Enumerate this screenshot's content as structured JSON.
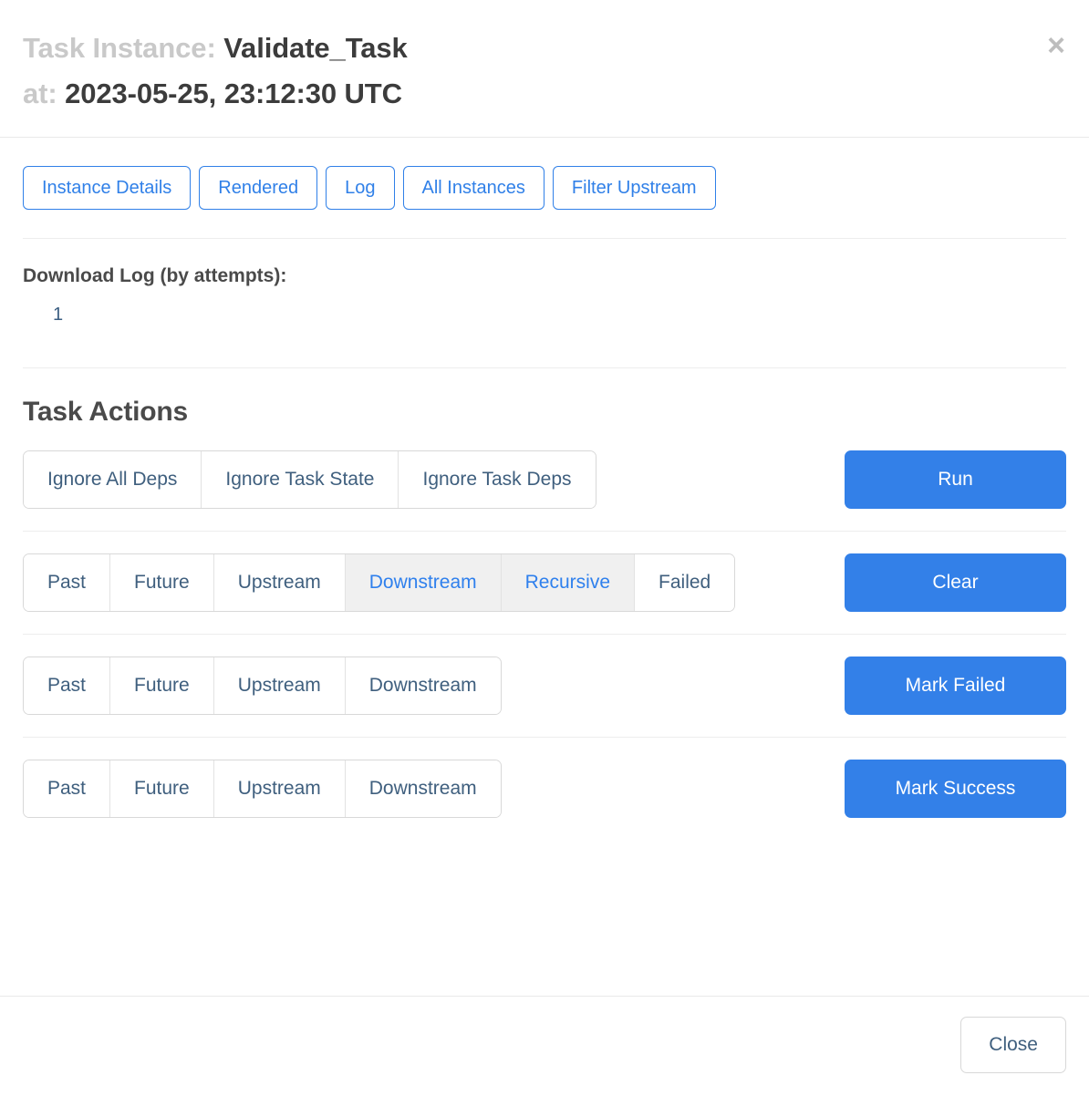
{
  "header": {
    "title_label": "Task Instance:",
    "title_value": "Validate_Task",
    "at_label": "at:",
    "at_value": "2023-05-25, 23:12:30 UTC",
    "close_icon": "×"
  },
  "tabs": [
    {
      "label": "Instance Details"
    },
    {
      "label": "Rendered"
    },
    {
      "label": "Log"
    },
    {
      "label": "All Instances"
    },
    {
      "label": "Filter Upstream"
    }
  ],
  "download_log": {
    "label": "Download Log (by attempts):",
    "attempts": [
      {
        "label": "1"
      }
    ]
  },
  "task_actions": {
    "heading": "Task Actions",
    "rows": [
      {
        "name": "run",
        "segments": [
          {
            "label": "Ignore All Deps",
            "active": false
          },
          {
            "label": "Ignore Task State",
            "active": false
          },
          {
            "label": "Ignore Task Deps",
            "active": false
          }
        ],
        "primary_label": "Run"
      },
      {
        "name": "clear",
        "segments": [
          {
            "label": "Past",
            "active": false
          },
          {
            "label": "Future",
            "active": false
          },
          {
            "label": "Upstream",
            "active": false
          },
          {
            "label": "Downstream",
            "active": true
          },
          {
            "label": "Recursive",
            "active": true
          },
          {
            "label": "Failed",
            "active": false
          }
        ],
        "primary_label": "Clear"
      },
      {
        "name": "mark-failed",
        "segments": [
          {
            "label": "Past",
            "active": false
          },
          {
            "label": "Future",
            "active": false
          },
          {
            "label": "Upstream",
            "active": false
          },
          {
            "label": "Downstream",
            "active": false
          }
        ],
        "primary_label": "Mark Failed"
      },
      {
        "name": "mark-success",
        "segments": [
          {
            "label": "Past",
            "active": false
          },
          {
            "label": "Future",
            "active": false
          },
          {
            "label": "Upstream",
            "active": false
          },
          {
            "label": "Downstream",
            "active": false
          }
        ],
        "primary_label": "Mark Success"
      }
    ]
  },
  "footer": {
    "close_label": "Close"
  },
  "colors": {
    "accent_blue": "#3380e8",
    "link_blue": "#3080e8",
    "slate_text": "#3f5f7e",
    "active_segment_bg": "#f0f0f0",
    "muted_title": "#c9c9c9",
    "divider": "#ededed"
  }
}
